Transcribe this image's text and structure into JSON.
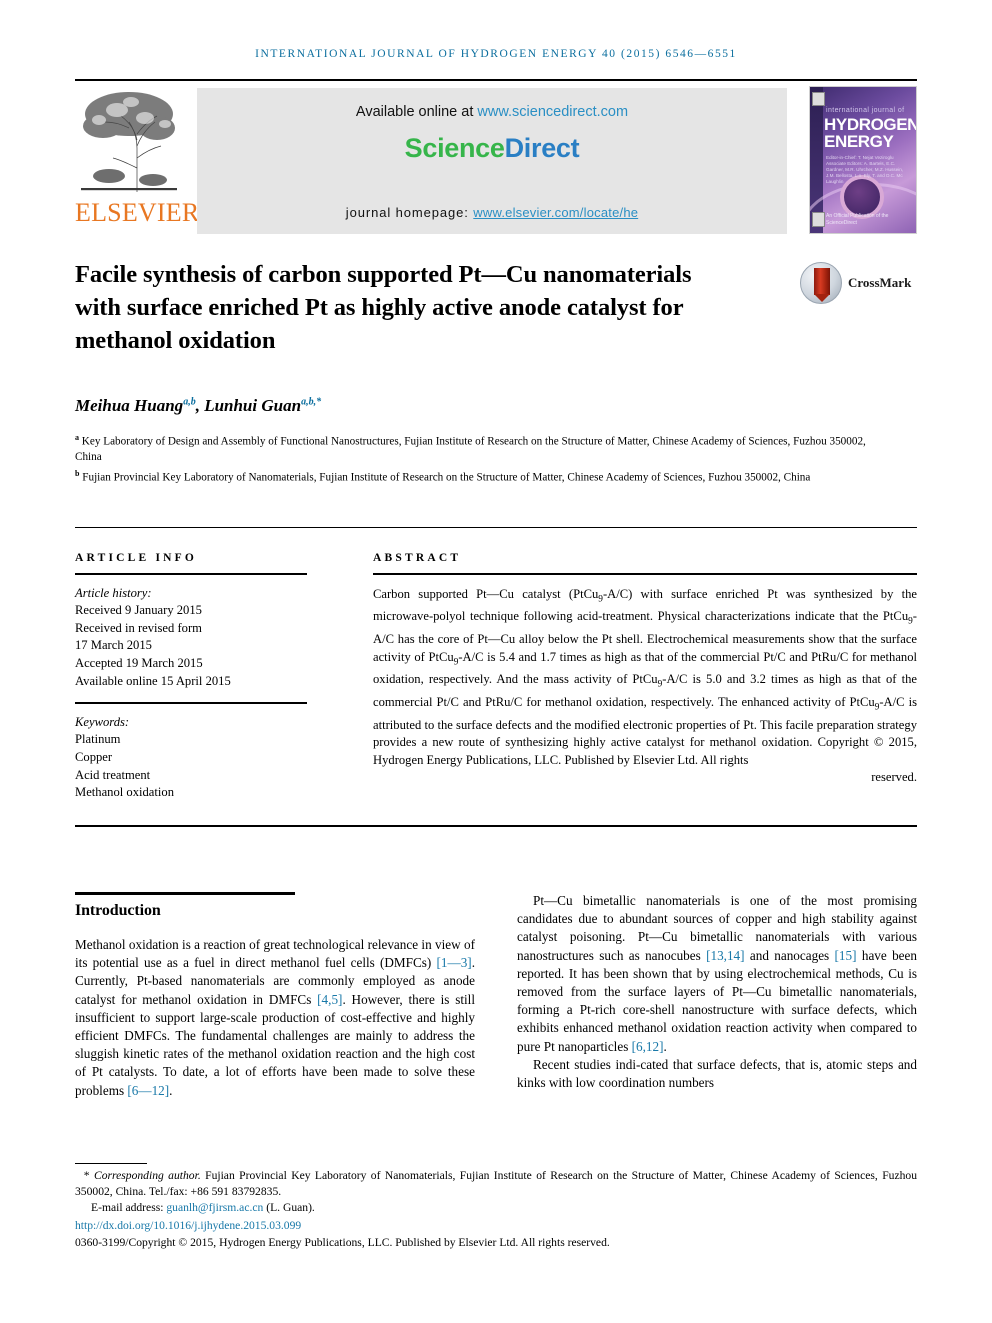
{
  "running_head": "International Journal of Hydrogen Energy 40 (2015) 6546—6551",
  "masthead": {
    "publisher_name": "ELSEVIER",
    "available_prefix": "Available online at ",
    "available_link": "www.sciencedirect.com",
    "sciencedirect_part1": "Science",
    "sciencedirect_part2": "Direct",
    "homepage_label": "journal homepage: ",
    "homepage_link": "www.elsevier.com/locate/he",
    "cover": {
      "kicker": "international journal of",
      "line1": "HYDROGEN",
      "line2": "ENERGY",
      "editors": "Editor-in-Chief: T. Nejat Veziroglu\nAssociate Editors: A. Bartels, E.C. Gardner, M.R. Uhrcher,\nM.Z. Hussein, J.M. Bellosta, L.o. Ely, T. and D.C. Mc Laughlin",
      "footer": "An Official Publication of the\nScienceDirect"
    }
  },
  "article": {
    "title": "Facile synthesis of carbon supported Pt—Cu nanomaterials with surface enriched Pt as highly active anode catalyst for methanol oxidation",
    "crossmark_label": "CrossMark",
    "authors": [
      {
        "name": "Meihua Huang",
        "sup": "a,b"
      },
      {
        "name": "Lunhui Guan",
        "sup": "a,b,*"
      }
    ],
    "affiliations": [
      {
        "marker": "a",
        "text": "Key Laboratory of Design and Assembly of Functional Nanostructures, Fujian Institute of Research on the Structure of Matter, Chinese Academy of Sciences, Fuzhou 350002, China"
      },
      {
        "marker": "b",
        "text": "Fujian Provincial Key Laboratory of Nanomaterials, Fujian Institute of Research on the Structure of Matter, Chinese Academy of Sciences, Fuzhou 350002, China"
      }
    ]
  },
  "article_info": {
    "label": "ARTICLE INFO",
    "history_label": "Article history:",
    "history": [
      "Received 9 January 2015",
      "Received in revised form",
      "17 March 2015",
      "Accepted 19 March 2015",
      "Available online 15 April 2015"
    ],
    "keywords_label": "Keywords:",
    "keywords": [
      "Platinum",
      "Copper",
      "Acid treatment",
      "Methanol oxidation"
    ]
  },
  "abstract": {
    "label": "ABSTRACT",
    "body": "Carbon supported Pt—Cu catalyst (PtCu9-A/C) with surface enriched Pt was synthesized by the microwave-polyol technique following acid-treatment. Physical characterizations indicate that the PtCu9-A/C has the core of Pt—Cu alloy below the Pt shell. Electrochemical measurements show that the surface activity of PtCu9-A/C is 5.4 and 1.7 times as high as that of the commercial Pt/C and PtRu/C for methanol oxidation, respectively. And the mass activity of PtCu9-A/C is 5.0 and 3.2 times as high as that of the commercial Pt/C and PtRu/C for methanol oxidation, respectively. The enhanced activity of PtCu9-A/C is attributed to the surface defects and the modified electronic properties of Pt. This facile preparation strategy provides a new route of synthesizing highly active catalyst for methanol oxidation.",
    "copyright": "Copyright © 2015, Hydrogen Energy Publications, LLC. Published by Elsevier Ltd. All rights",
    "copyright_last": "reserved."
  },
  "body": {
    "intro_heading": "Introduction",
    "left_paragraph": "Methanol oxidation is a reaction of great technological relevance in view of its potential use as a fuel in direct methanol fuel cells (DMFCs) [1—3]. Currently, Pt-based nanomaterials are commonly employed as anode catalyst for methanol oxidation in DMFCs [4,5]. However, there is still insufficient to support large-scale production of cost-effective and highly efficient DMFCs. The fundamental challenges are mainly to address the sluggish kinetic rates of the methanol oxidation reaction and the high cost of Pt catalysts. To date, a lot of efforts have been made to solve these problems [6—12].",
    "right_paragraph_1": "Pt—Cu bimetallic nanomaterials is one of the most promising candidates due to abundant sources of copper and high stability against catalyst poisoning. Pt—Cu bimetallic nanomaterials with various nanostructures such as nanocubes [13,14] and nanocages [15] have been reported. It has been shown that by using electrochemical methods, Cu is removed from the surface layers of Pt—Cu bimetallic nanomaterials, forming a Pt-rich core-shell nanostructure with surface defects, which exhibits enhanced methanol oxidation reaction activity when compared to pure Pt nanoparticles [6,12].",
    "right_paragraph_2": "Recent studies indi-cated that surface defects, that is, atomic steps and kinks with low coordination numbers"
  },
  "footer": {
    "corresponding_marker": "*",
    "corresponding_label": "Corresponding author.",
    "corresponding_text": " Fujian Provincial Key Laboratory of Nanomaterials, Fujian Institute of Research on the Structure of Matter, Chinese Academy of Sciences, Fuzhou 350002, China. Tel./fax: +86 591 83792835.",
    "email_label": "E-mail address: ",
    "email": "guanlh@fjirsm.ac.cn",
    "email_suffix": " (L. Guan).",
    "doi": "http://dx.doi.org/10.1016/j.ijhydene.2015.03.099",
    "copyright_line": "0360-3199/Copyright © 2015, Hydrogen Energy Publications, LLC. Published by Elsevier Ltd. All rights reserved."
  },
  "colors": {
    "link_blue": "#1878a8",
    "running_head_blue": "#0b6e9e",
    "elsevier_orange": "#e87722",
    "sciencedirect_green": "#36b54a",
    "sciencedirect_blue": "#2a7fc4"
  }
}
